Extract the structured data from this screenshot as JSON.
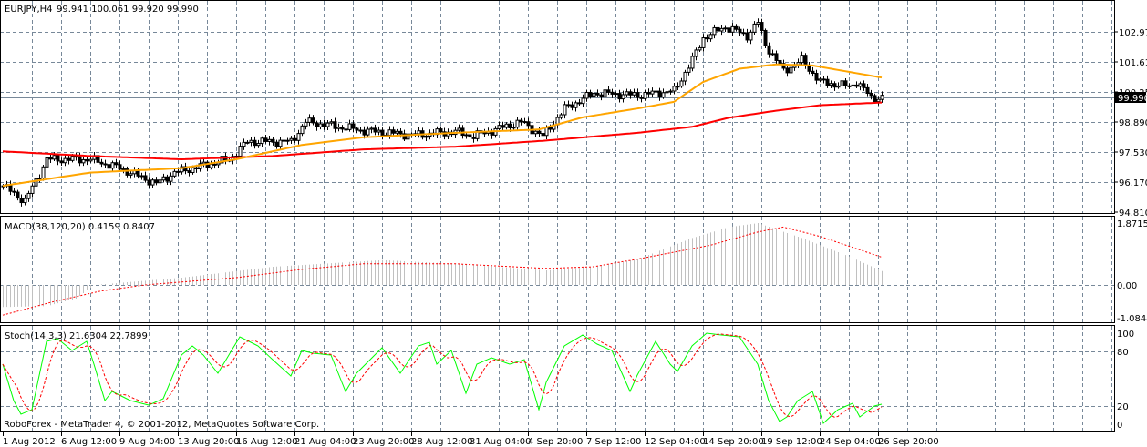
{
  "main": {
    "symbol_label": "EURJPY,H4",
    "ohlc_label": "99.941 100.061 99.920 99.990",
    "price_ticks": [
      "102.970",
      "101.610",
      "100.250",
      "98.890",
      "97.530",
      "96.170",
      "94.810"
    ],
    "price_tick_values": [
      102.97,
      101.61,
      100.25,
      98.89,
      97.53,
      96.17,
      94.81
    ],
    "current_price": "99.990",
    "current_price_value": 99.99,
    "price_range": [
      94.81,
      103.65
    ]
  },
  "macd": {
    "label": "MACD(38,120,20) 0.4159 0.8407",
    "ticks": [
      "1.8715",
      "0.00",
      "-1.0844"
    ],
    "tick_values": [
      1.8715,
      0,
      -1.0844
    ],
    "range": [
      -1.0844,
      1.8715
    ]
  },
  "stoch": {
    "label": "Stoch(14,3,3) 21.6304 22.7899",
    "ticks": [
      "100",
      "80",
      "20",
      "0"
    ],
    "tick_values": [
      100,
      80,
      20,
      0
    ]
  },
  "copyright": "RoboForex - MetaTrader 4, © 2001-2012, MetaQuotes Software Corp.",
  "time_labels": [
    "1 Aug 2012",
    "6 Aug 12:00",
    "9 Aug 04:00",
    "13 Aug 20:00",
    "16 Aug 12:00",
    "21 Aug 04:00",
    "23 Aug 20:00",
    "28 Aug 12:00",
    "31 Aug 04:00",
    "4 Sep 20:00",
    "7 Sep 12:00",
    "12 Sep 04:00",
    "14 Sep 20:00",
    "19 Sep 12:00",
    "24 Sep 04:00",
    "26 Sep 20:00"
  ],
  "colors": {
    "ma_fast": "#FFA500",
    "ma_slow": "#FF0000",
    "stoch_main": "#00FF00",
    "stoch_signal": "#FF0000",
    "macd_hist": "#C0C0C0",
    "macd_signal": "#FF0000",
    "grid": "#778899"
  },
  "chart_data": {
    "type": "candlestick",
    "bar_count": 242,
    "close_path": [
      [
        0,
        96.0
      ],
      [
        6,
        95.3
      ],
      [
        12,
        97.2
      ],
      [
        24,
        97.2
      ],
      [
        32,
        96.8
      ],
      [
        42,
        96.1
      ],
      [
        47,
        96.6
      ],
      [
        62,
        97.2
      ],
      [
        67,
        98.0
      ],
      [
        79,
        98.0
      ],
      [
        83,
        98.9
      ],
      [
        99,
        98.5
      ],
      [
        112,
        98.3
      ],
      [
        124,
        98.45
      ],
      [
        129,
        98.25
      ],
      [
        142,
        98.9
      ],
      [
        148,
        98.25
      ],
      [
        154,
        99.5
      ],
      [
        162,
        100.2
      ],
      [
        174,
        100.1
      ],
      [
        184,
        100.3
      ],
      [
        189,
        101.7
      ],
      [
        192,
        102.7
      ],
      [
        198,
        103.2
      ],
      [
        204,
        102.8
      ],
      [
        207,
        103.4
      ],
      [
        209,
        102.4
      ],
      [
        214,
        101.2
      ],
      [
        219,
        101.7
      ],
      [
        224,
        100.7
      ],
      [
        232,
        100.5
      ],
      [
        234,
        100.7
      ],
      [
        238,
        100.0
      ],
      [
        241,
        99.99
      ]
    ],
    "ma_fast_path": [
      [
        0,
        96.0
      ],
      [
        12,
        96.3
      ],
      [
        24,
        96.6
      ],
      [
        49,
        96.8
      ],
      [
        64,
        97.2
      ],
      [
        82,
        97.85
      ],
      [
        99,
        98.2
      ],
      [
        124,
        98.4
      ],
      [
        147,
        98.55
      ],
      [
        159,
        99.1
      ],
      [
        174,
        99.5
      ],
      [
        184,
        99.8
      ],
      [
        192,
        100.7
      ],
      [
        202,
        101.3
      ],
      [
        212,
        101.5
      ],
      [
        222,
        101.45
      ],
      [
        241,
        100.9
      ]
    ],
    "ma_slow_path": [
      [
        0,
        97.56
      ],
      [
        24,
        97.35
      ],
      [
        49,
        97.2
      ],
      [
        74,
        97.35
      ],
      [
        99,
        97.65
      ],
      [
        124,
        97.77
      ],
      [
        149,
        98.05
      ],
      [
        174,
        98.4
      ],
      [
        189,
        98.67
      ],
      [
        199,
        99.08
      ],
      [
        212,
        99.4
      ],
      [
        224,
        99.65
      ],
      [
        241,
        99.77
      ]
    ],
    "macd_hist_path": [
      [
        0,
        -0.73
      ],
      [
        12,
        -0.7
      ],
      [
        20,
        -0.45
      ],
      [
        25,
        0.0
      ],
      [
        49,
        0.22
      ],
      [
        74,
        0.55
      ],
      [
        104,
        0.75
      ],
      [
        124,
        0.64
      ],
      [
        149,
        0.44
      ],
      [
        162,
        0.55
      ],
      [
        174,
        0.78
      ],
      [
        189,
        1.42
      ],
      [
        199,
        1.75
      ],
      [
        207,
        1.87
      ],
      [
        219,
        1.42
      ],
      [
        232,
        0.86
      ],
      [
        241,
        0.42
      ]
    ],
    "macd_signal_path": [
      [
        0,
        -1.0
      ],
      [
        14,
        -0.55
      ],
      [
        27,
        -0.2
      ],
      [
        39,
        0.0
      ],
      [
        64,
        0.22
      ],
      [
        82,
        0.47
      ],
      [
        99,
        0.64
      ],
      [
        124,
        0.64
      ],
      [
        149,
        0.5
      ],
      [
        162,
        0.55
      ],
      [
        174,
        0.78
      ],
      [
        194,
        1.2
      ],
      [
        207,
        1.6
      ],
      [
        214,
        1.75
      ],
      [
        224,
        1.47
      ],
      [
        241,
        0.84
      ]
    ],
    "stoch_main_path": [
      [
        0,
        66
      ],
      [
        3,
        26
      ],
      [
        5,
        11
      ],
      [
        8,
        16
      ],
      [
        12,
        91
      ],
      [
        15,
        94
      ],
      [
        19,
        81
      ],
      [
        23,
        91
      ],
      [
        25,
        66
      ],
      [
        28,
        26
      ],
      [
        30,
        36
      ],
      [
        35,
        26
      ],
      [
        40,
        21
      ],
      [
        44,
        28
      ],
      [
        49,
        76
      ],
      [
        52,
        86
      ],
      [
        55,
        76
      ],
      [
        59,
        56
      ],
      [
        62,
        76
      ],
      [
        65,
        96
      ],
      [
        70,
        86
      ],
      [
        74,
        71
      ],
      [
        79,
        53
      ],
      [
        82,
        81
      ],
      [
        85,
        78
      ],
      [
        90,
        76
      ],
      [
        94,
        36
      ],
      [
        97,
        56
      ],
      [
        102,
        76
      ],
      [
        104,
        84
      ],
      [
        109,
        56
      ],
      [
        114,
        86
      ],
      [
        117,
        90
      ],
      [
        119,
        66
      ],
      [
        123,
        81
      ],
      [
        127,
        34
      ],
      [
        130,
        66
      ],
      [
        134,
        73
      ],
      [
        139,
        66
      ],
      [
        143,
        71
      ],
      [
        147,
        16
      ],
      [
        149,
        46
      ],
      [
        154,
        86
      ],
      [
        159,
        98
      ],
      [
        163,
        88
      ],
      [
        167,
        81
      ],
      [
        172,
        36
      ],
      [
        174,
        54
      ],
      [
        179,
        91
      ],
      [
        183,
        66
      ],
      [
        185,
        58
      ],
      [
        189,
        86
      ],
      [
        193,
        100
      ],
      [
        197,
        98
      ],
      [
        202,
        96
      ],
      [
        207,
        66
      ],
      [
        210,
        26
      ],
      [
        213,
        3
      ],
      [
        215,
        8
      ],
      [
        218,
        26
      ],
      [
        222,
        36
      ],
      [
        225,
        1
      ],
      [
        229,
        16
      ],
      [
        233,
        23
      ],
      [
        235,
        8
      ],
      [
        239,
        20
      ],
      [
        241,
        22
      ]
    ]
  }
}
